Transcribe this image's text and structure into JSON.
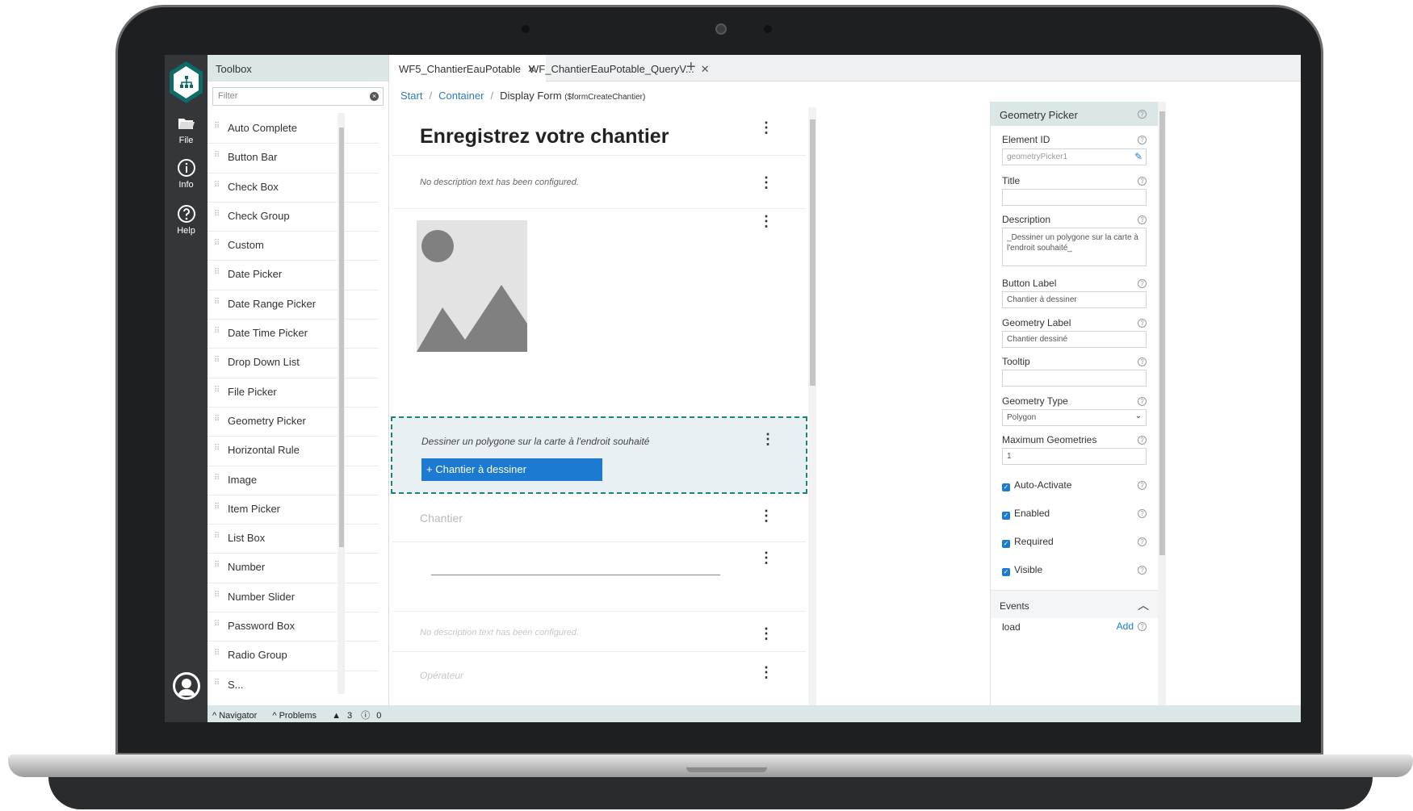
{
  "rail": {
    "file_label": "File",
    "info_label": "Info",
    "help_label": "Help"
  },
  "toolbox": {
    "title": "Toolbox",
    "filter_placeholder": "Filter",
    "items": [
      "Auto Complete",
      "Button Bar",
      "Check Box",
      "Check Group",
      "Custom",
      "Date Picker",
      "Date Range Picker",
      "Date Time Picker",
      "Drop Down List",
      "File Picker",
      "Geometry Picker",
      "Horizontal Rule",
      "Image",
      "Item Picker",
      "List Box",
      "Number",
      "Number Slider",
      "Password Box",
      "Radio Group",
      "S..."
    ]
  },
  "tabs": [
    {
      "label": "WF5_ChantierEauPotable"
    },
    {
      "label": "WF_ChantierEauPotable_QueryV..."
    }
  ],
  "breadcrumb": {
    "start": "Start",
    "container": "Container",
    "current": "Display Form",
    "current_id": "($formCreateChantier)"
  },
  "form": {
    "title": "Enregistrez votre chantier",
    "no_description": "No description text has been configured.",
    "geometry_description": "Dessiner un polygone sur la carte à l'endroit souhaité",
    "geometry_button": "+ Chantier à dessiner",
    "chantier_label": "Chantier",
    "no_description_faded": "No description text has been configured.",
    "operateur_label": "Opérateur"
  },
  "properties": {
    "title": "Geometry Picker",
    "element_id_label": "Element ID",
    "element_id_value": "geometryPicker1",
    "title_label": "Title",
    "title_value": "",
    "description_label": "Description",
    "description_value": "_Dessiner un polygone sur la carte à l'endroit souhaité_",
    "button_label_label": "Button Label",
    "button_label_value": "Chantier à dessiner",
    "geometry_label_label": "Geometry Label",
    "geometry_label_value": "Chantier dessiné",
    "tooltip_label": "Tooltip",
    "tooltip_value": "",
    "geometry_type_label": "Geometry Type",
    "geometry_type_value": "Polygon",
    "max_geometries_label": "Maximum Geometries",
    "max_geometries_value": "1",
    "auto_activate_label": "Auto-Activate",
    "enabled_label": "Enabled",
    "required_label": "Required",
    "visible_label": "Visible",
    "events_label": "Events",
    "load_label": "load",
    "add_label": "Add"
  },
  "status": {
    "navigator": "Navigator",
    "problems": "Problems",
    "warnings": "3",
    "infos": "0"
  },
  "colors": {
    "accent": "#1c7bd1",
    "teal": "#0d6b68",
    "panel_header": "#dbe6e6",
    "rail": "#35363a"
  }
}
